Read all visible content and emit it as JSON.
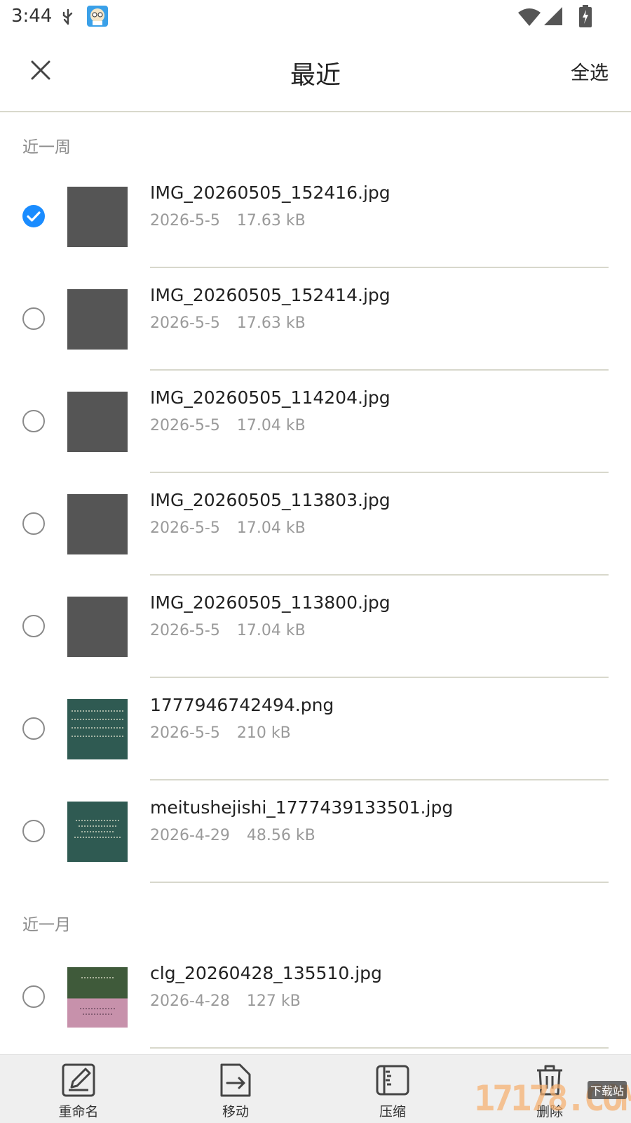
{
  "status_bar": {
    "time": "3:44",
    "icons": [
      "usb-debug-icon",
      "app-notification-icon",
      "wifi-icon",
      "cell-signal-icon",
      "battery-charging-icon"
    ]
  },
  "header": {
    "title": "最近",
    "select_all_label": "全选",
    "close_icon": "close-icon"
  },
  "sections": [
    {
      "label": "近一周",
      "files": [
        {
          "name": "IMG_20260505_152416.jpg",
          "date": "2026-5-5",
          "size": "17.63 kB",
          "checked": true
        },
        {
          "name": "IMG_20260505_152414.jpg",
          "date": "2026-5-5",
          "size": "17.63 kB",
          "checked": false
        },
        {
          "name": "IMG_20260505_114204.jpg",
          "date": "2026-5-5",
          "size": "17.04 kB",
          "checked": false
        },
        {
          "name": "IMG_20260505_113803.jpg",
          "date": "2026-5-5",
          "size": "17.04 kB",
          "checked": false
        },
        {
          "name": "IMG_20260505_113800.jpg",
          "date": "2026-5-5",
          "size": "17.04 kB",
          "checked": false
        },
        {
          "name": "1777946742494.png",
          "date": "2026-5-5",
          "size": "210 kB",
          "checked": false
        },
        {
          "name": "meitushejishi_1777439133501.jpg",
          "date": "2026-4-29",
          "size": "48.56 kB",
          "checked": false
        }
      ]
    },
    {
      "label": "近一月",
      "files": [
        {
          "name": "clg_20260428_135510.jpg",
          "date": "2026-4-28",
          "size": "127 kB",
          "checked": false
        }
      ]
    }
  ],
  "actions": [
    {
      "label": "重命名",
      "icon": "rename-icon"
    },
    {
      "label": "移动",
      "icon": "move-icon"
    },
    {
      "label": "压缩",
      "icon": "compress-icon"
    },
    {
      "label": "删除",
      "icon": "delete-icon"
    }
  ],
  "watermark": {
    "text": "17178.COM",
    "tag": "下载站"
  },
  "colors": {
    "accent": "#1a8cff",
    "divider": "#d8d8cc",
    "secondary_text": "#9a9a9a",
    "bottom_bar": "#efefef"
  }
}
